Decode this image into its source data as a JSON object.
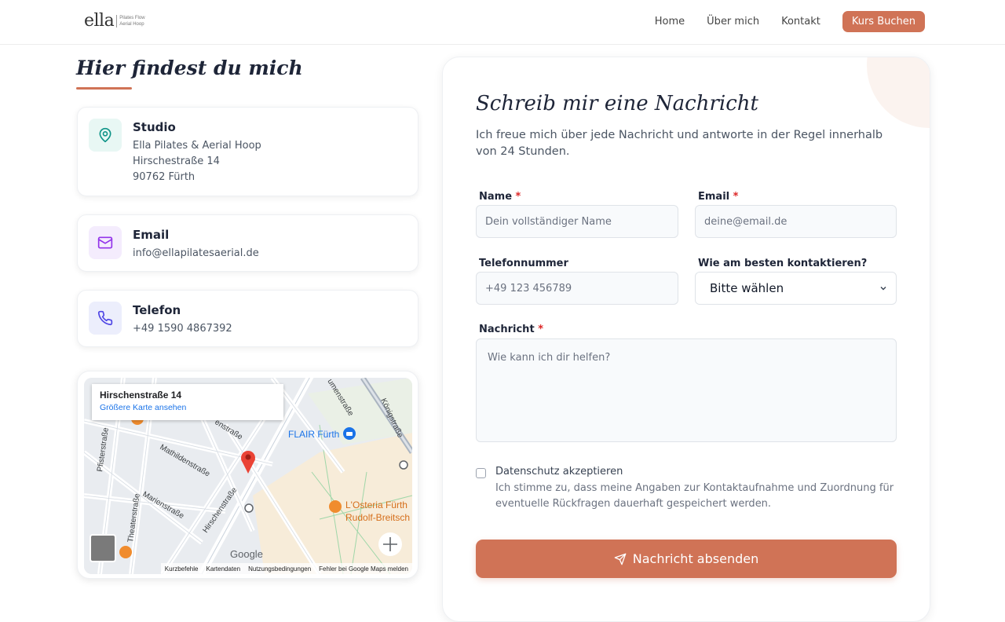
{
  "header": {
    "logo_word": "ella",
    "logo_sub_1": "Pilates Flow",
    "logo_sub_2": "Aerial Hoop",
    "nav": [
      "Home",
      "Über mich",
      "Kontakt"
    ],
    "cta": "Kurs Buchen"
  },
  "contact": {
    "heading": "Hier findest du mich",
    "studio": {
      "title": "Studio",
      "lines": [
        "Ella Pilates & Aerial Hoop",
        "Hirschestraße 14",
        "90762 Fürth"
      ]
    },
    "email": {
      "title": "Email",
      "value": "info@ellapilatesaerial.de"
    },
    "phone": {
      "title": "Telefon",
      "value": "+49 1590 4867392"
    }
  },
  "map": {
    "info_title": "Hirschenstraße 14",
    "info_link": "Größere Karte ansehen",
    "labels": {
      "flair": "FLAIR Fürth",
      "osteria_1": "L'Osteria Fürth",
      "osteria_2": "Rudolf-Breitsch",
      "mathilden": "Mathildenstraße",
      "marien": "Marienstraße",
      "hirschen": "Hirschenstraße",
      "theater": "Theaterstraße",
      "pfister": "Pfisterstraße",
      "koenig": "Königstraße",
      "hirschen_top": "enstraße",
      "gustav": "umenstraße"
    },
    "google": "Google",
    "footer": [
      "Kurzbefehle",
      "Kartendaten",
      "Nutzungsbedingungen",
      "Fehler bei Google Maps melden"
    ]
  },
  "form": {
    "title": "Schreib mir eine Nachricht",
    "intro": "Ich freue mich über jede Nachricht und antworte in der Regel innerhalb von 24 Stunden.",
    "name_label": "Name",
    "name_placeholder": "Dein vollständiger Name",
    "email_label": "Email",
    "email_placeholder": "deine@email.de",
    "phone_label": "Telefonnummer",
    "phone_placeholder": "+49 123 456789",
    "contact_label": "Wie am besten kontaktieren?",
    "contact_value": "Bitte wählen",
    "message_label": "Nachricht",
    "message_placeholder": "Wie kann ich dir helfen?",
    "required_mark": "*",
    "privacy_label": "Datenschutz akzeptieren",
    "privacy_text": "Ich stimme zu, dass meine Angaben zur Kontaktaufnahme und Zuordnung für eventuelle Rückfragen dauerhaft gespeichert werden.",
    "submit": "Nachricht absenden"
  },
  "colors": {
    "accent": "#d07356",
    "heading": "#1e2538",
    "studio_icon": "#0f9488",
    "email_icon": "#9333ea",
    "phone_icon": "#4f46e5"
  }
}
